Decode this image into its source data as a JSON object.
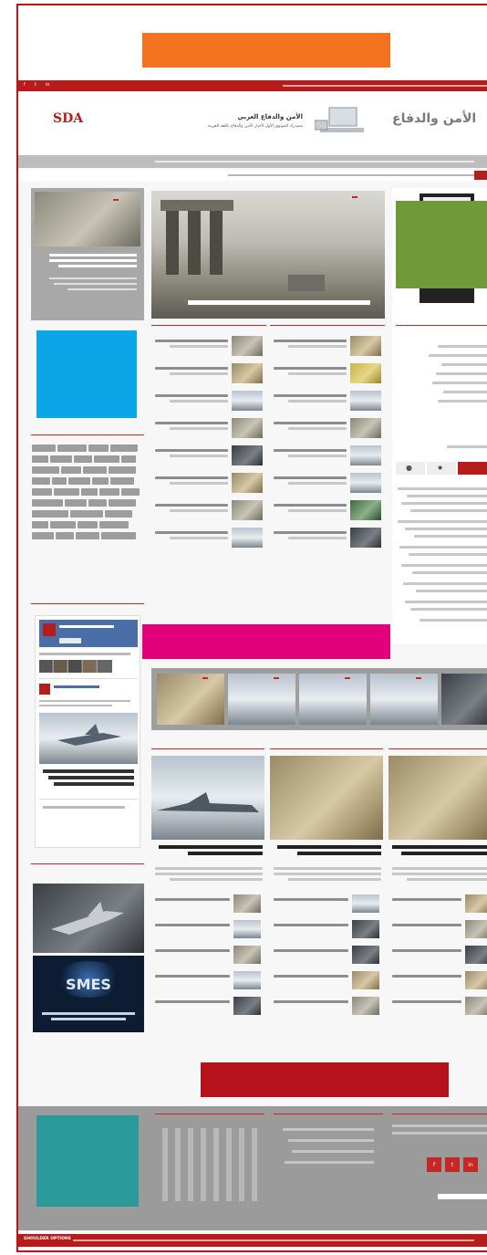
{
  "header": {
    "site_title": "الأمن والدفاع العربي",
    "site_subtitle": "مصدرك الموثوق الأول لأخبار الأمن والدفاع باللغة العربية",
    "logo_left": "SDA",
    "logo_right": "الأمن والدفاع"
  },
  "social": {
    "icons": [
      "f",
      "t",
      "in"
    ]
  },
  "colors": {
    "brand_red": "#b71c1c",
    "ad_orange": "#f47321",
    "ad_green": "#6f9a3a",
    "ad_blue": "#0aa6e8",
    "ad_magenta": "#e2007a",
    "ad_teal": "#2b9a9a"
  },
  "footer": {
    "label": "SHOULDER OPTIONS"
  }
}
